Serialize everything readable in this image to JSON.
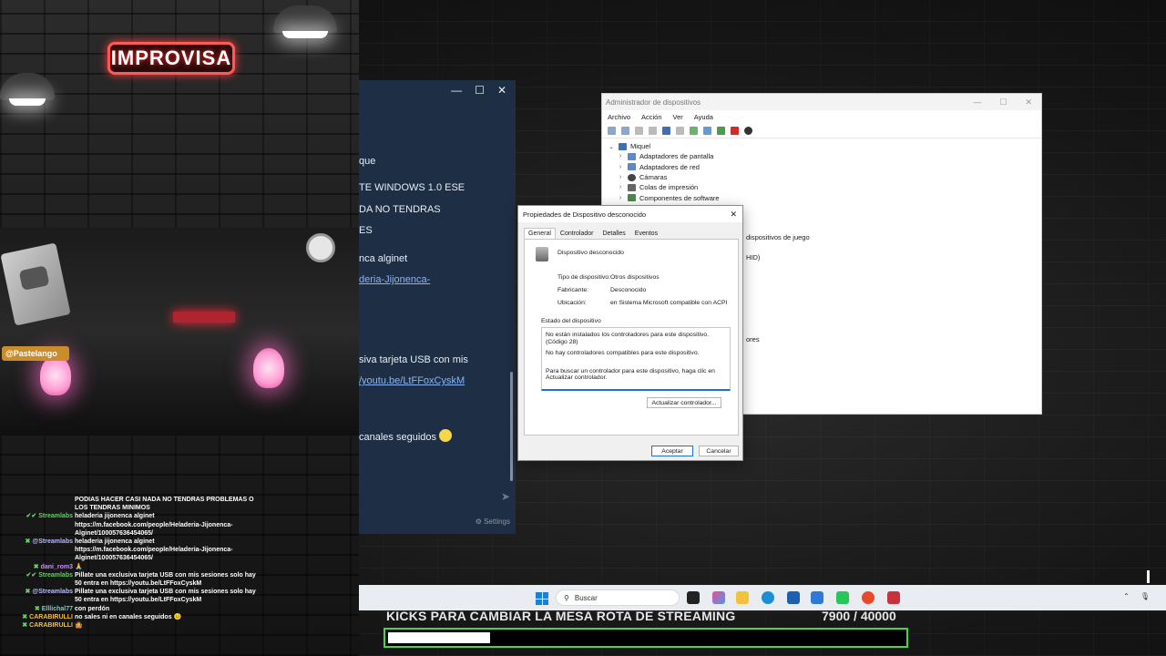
{
  "overlay": {
    "logo_text": "IMPROVISA",
    "handle_badge": "@Pastelango"
  },
  "chat": [
    {
      "user": "",
      "text": "PODIAS HACER CASI NADA NO TENDRAS PROBLEMAS O LOS TENDRAS MINIMOS"
    },
    {
      "user": "Streamlabs",
      "text": "heladeria jijonenca alginet https://m.facebook.com/people/Heladeria-Jijonenca-Alginet/100057636454065/"
    },
    {
      "user": "@Streamlabs",
      "text": "heladeria jijonenca alginet https://m.facebook.com/people/Heladeria-Jijonenca-Alginet/100057636454065/"
    },
    {
      "user": "dani_rom3",
      "text": "🙏"
    },
    {
      "user": "Streamlabs",
      "text": "Pillate una exclusiva tarjeta USB con mis sesiones solo hay 50 entra en https://youtu.be/LtFFoxCyskM"
    },
    {
      "user": "@Streamlabs",
      "text": "Pillate una exclusiva tarjeta USB con mis sesiones solo hay 50 entra en https://youtu.be/LtFFoxCyskM"
    },
    {
      "user": "Elllichal77",
      "text": "con perdón"
    },
    {
      "user": "CARABIRULLI",
      "text": "no sales ni en canales seguidos 😐"
    },
    {
      "user": "CARABIRULLI",
      "text": "🤷"
    }
  ],
  "side_window": {
    "lines": [
      "que",
      "TE WINDOWS 1.0 ESE",
      "DA NO TENDRAS",
      "ES",
      "nca alginet",
      "deria-Jijonenca-",
      "siva tarjeta USB con mis",
      "/youtu.be/LtFFoxCyskM",
      "canales seguidos"
    ],
    "settings_label": "Settings"
  },
  "device_manager": {
    "title": "Administrador de dispositivos",
    "menu": [
      "Archivo",
      "Acción",
      "Ver",
      "Ayuda"
    ],
    "tree_root": "Miquel",
    "tree_items": [
      "Adaptadores de pantalla",
      "Adaptadores de red",
      "Cámaras",
      "Colas de impresión",
      "Componentes de software"
    ],
    "partial_items": [
      "dispositivos de juego",
      "HID)",
      "ores"
    ]
  },
  "dialog": {
    "title": "Propiedades de Dispositivo desconocido",
    "tabs": [
      "General",
      "Controlador",
      "Detalles",
      "Eventos"
    ],
    "device_name": "Dispositivo desconocido",
    "type_label": "Tipo de dispositivo:",
    "type_value": "Otros dispositivos",
    "maker_label": "Fabricante:",
    "maker_value": "Desconocido",
    "location_label": "Ubicación:",
    "location_value": "en Sistema Microsoft compatible con ACPI",
    "status_group": "Estado del dispositivo",
    "status_text_1": "No están instalados los controladores para este dispositivo. (Código 28)",
    "status_text_2": "No hay controladores compatibles para este dispositivo.",
    "status_text_3": "Para buscar un controlador para este dispositivo, haga clic en Actualizar controlador.",
    "update_button": "Actualizar controlador...",
    "ok_button": "Aceptar",
    "cancel_button": "Cancelar"
  },
  "taskbar": {
    "search_placeholder": "Buscar"
  },
  "goal": {
    "title": "KICKS PARA CAMBIAR LA MESA ROTA DE STREAMING",
    "current": "7900",
    "target": "/ 40000",
    "progress_fraction": 0.1975
  },
  "colors": {
    "goal_border": "#3fdc3f",
    "logo_neon": "#ff5a5a",
    "side_window_bg": "#1e2f45",
    "link": "#8ab4f8"
  }
}
